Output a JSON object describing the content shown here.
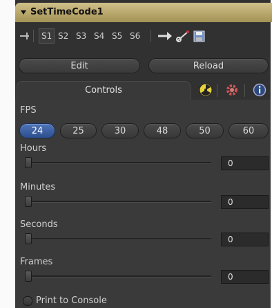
{
  "tool": {
    "title": "SetTimeCode1"
  },
  "toolbar": {
    "slots": [
      "S1",
      "S2",
      "S3",
      "S4",
      "S5",
      "S6"
    ],
    "active_slot": "S1"
  },
  "buttons": {
    "edit": "Edit",
    "reload": "Reload"
  },
  "tabs": {
    "controls": "Controls",
    "icons": [
      "radioactive-icon",
      "gear-icon",
      "info-icon"
    ]
  },
  "fps": {
    "label": "FPS",
    "options": [
      "24",
      "25",
      "30",
      "48",
      "50",
      "60"
    ],
    "selected": "24"
  },
  "sliders": [
    {
      "label": "Hours",
      "value": "0"
    },
    {
      "label": "Minutes",
      "value": "0"
    },
    {
      "label": "Seconds",
      "value": "0"
    },
    {
      "label": "Frames",
      "value": "0"
    }
  ],
  "print_to_console": {
    "label": "Print to Console",
    "checked": false
  },
  "colors": {
    "title_bar": "#b8a76b",
    "active_button": "#3b5fa0",
    "panel_bg": "#3a3a3a"
  }
}
